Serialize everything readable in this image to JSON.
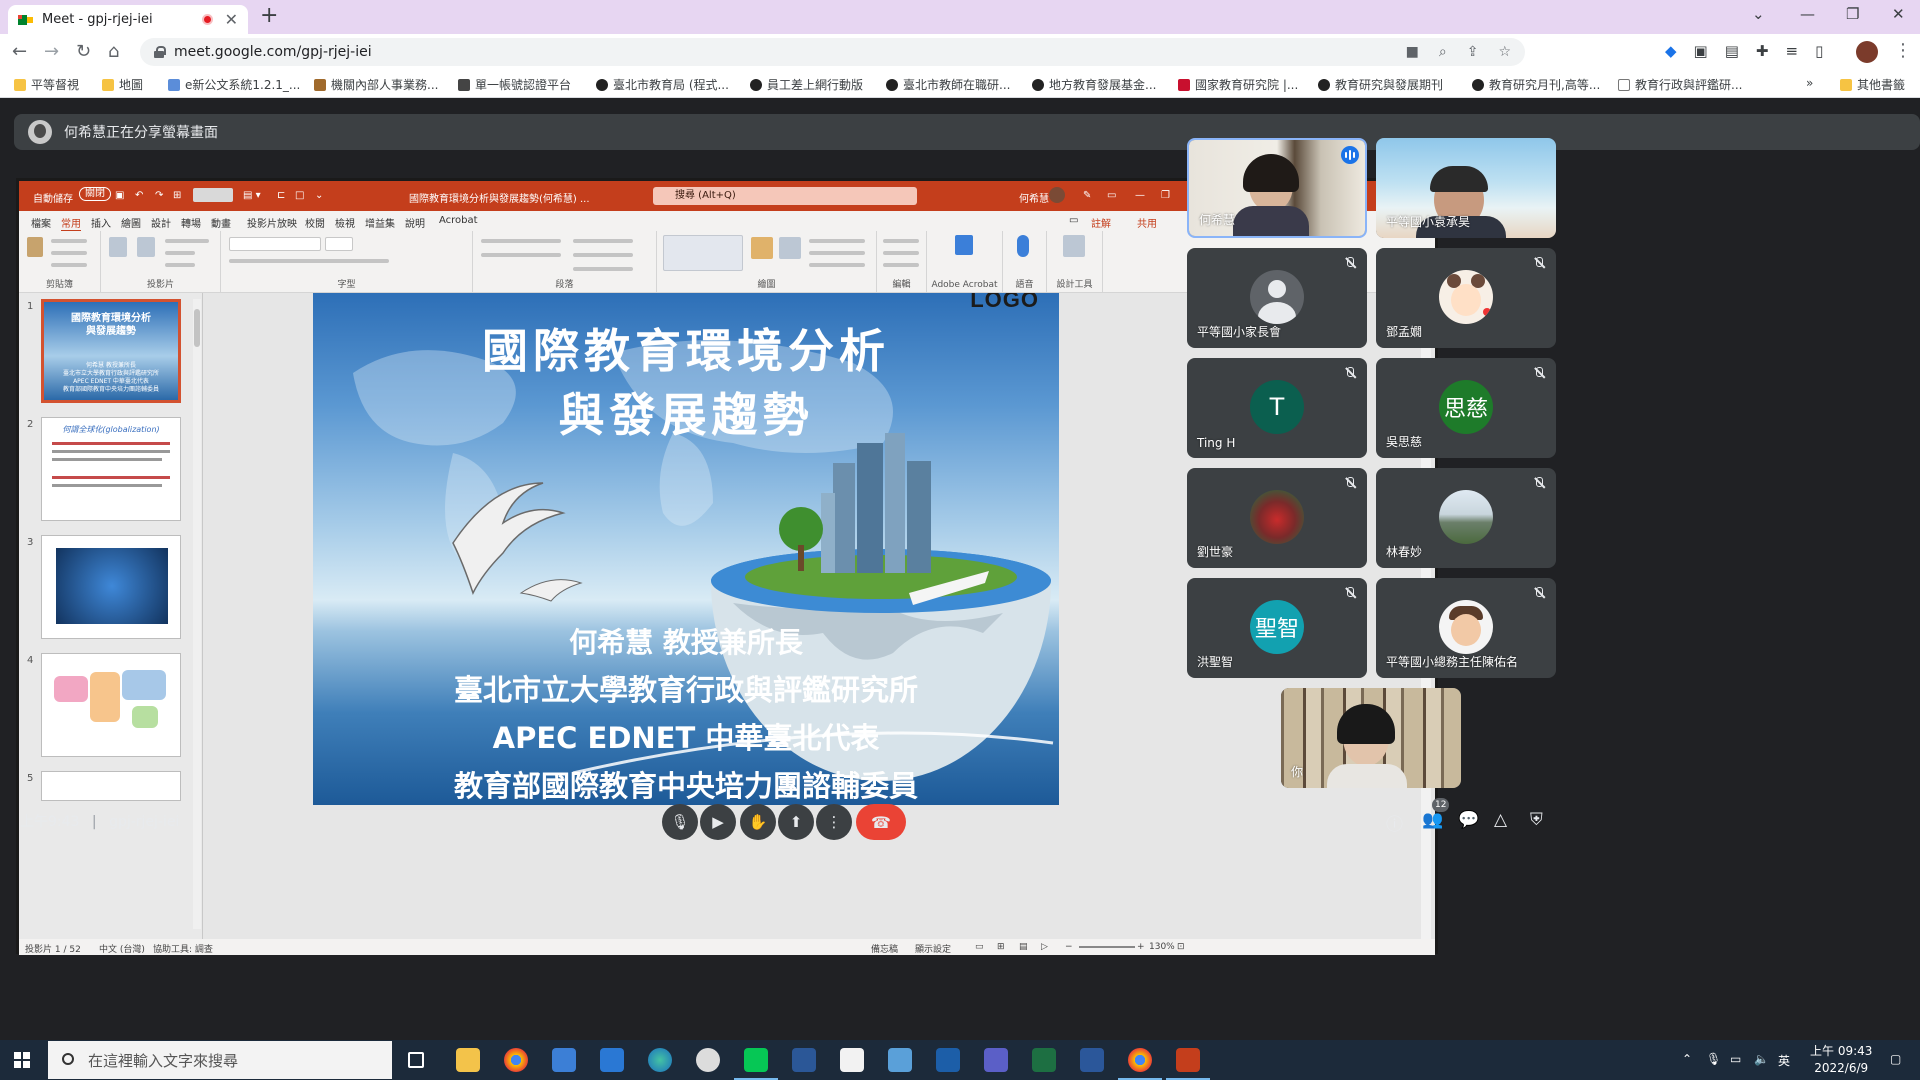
{
  "browser": {
    "tab_title": "Meet - gpj-rjej-iei",
    "url": "meet.google.com/gpj-rjej-iei",
    "bookmarks": [
      "平等督視",
      "地圖",
      "e新公文系統1.2.1_...",
      "機關內部人事業務...",
      "單一帳號認證平台",
      "臺北市教育局 (程式...",
      "員工差上網行動版",
      "臺北市教師在職研...",
      "地方教育發展基金...",
      "國家教育研究院 |...",
      "教育研究與發展期刊",
      "教育研究月刊,高等...",
      "教育行政與評鑑研...",
      "其他書籤"
    ]
  },
  "meet": {
    "presenting_text": "何希慧正在分享螢幕畫面",
    "meeting_code": "gpj-rjej-iei",
    "time": "上午9:43",
    "participant_count": "12",
    "participants": [
      {
        "name": "何希慧",
        "kind": "video",
        "speaking": true
      },
      {
        "name": "平等國小袁承昊",
        "kind": "video"
      },
      {
        "name": "平等國小家長會",
        "kind": "default",
        "muted": true
      },
      {
        "name": "鄧孟嫺",
        "kind": "emoji",
        "muted": true
      },
      {
        "name": "Ting H",
        "kind": "letter",
        "letter": "T",
        "color": "#0b5f4f",
        "muted": true
      },
      {
        "name": "吳思慈",
        "kind": "letter",
        "letter": "思慈",
        "color": "#1e7b2a",
        "muted": true
      },
      {
        "name": "劉世豪",
        "kind": "photo",
        "muted": true
      },
      {
        "name": "林春妙",
        "kind": "photo",
        "muted": true
      },
      {
        "name": "洪聖智",
        "kind": "letter",
        "letter": "聖智",
        "color": "#12a1b0",
        "muted": true
      },
      {
        "name": "平等國小總務主任陳佑名",
        "kind": "emoji",
        "muted": true
      },
      {
        "name": "你",
        "kind": "self"
      }
    ]
  },
  "ppt": {
    "autosave": "自動儲存",
    "autosave_state": "關閉",
    "doc_title": "國際教育環境分析與發展趨勢(何希慧) ...",
    "search_placeholder": "搜尋 (Alt+Q)",
    "user": "何希慧",
    "menu": [
      "檔案",
      "常用",
      "插入",
      "繪圖",
      "設計",
      "轉場",
      "動畫",
      "投影片放映",
      "校閱",
      "檢視",
      "增益集",
      "說明",
      "Acrobat"
    ],
    "active_menu": "常用",
    "comment_btn": "註解",
    "share_btn": "共用",
    "ribbon_groups": [
      "剪貼簿",
      "投影片",
      "字型",
      "段落",
      "繪圖",
      "編輯",
      "Adobe Acrobat",
      "語音",
      "設計工具"
    ],
    "status_left": "投影片 1 / 52",
    "status_lang": "中文 (台灣)",
    "status_access": "協助工具: 調查",
    "status_notes": "備忘稿",
    "status_display": "顯示設定",
    "zoom": "130%",
    "thumb2_title": "何謂全球化(globalization)",
    "slide": {
      "logo": "LOGO",
      "title_line1": "國際教育環境分析",
      "title_line2": "與發展趨勢",
      "sub1": "何希慧 教授兼所長",
      "sub2": "臺北市立大學教育行政與評鑑研究所",
      "sub3": "APEC EDNET 中華臺北代表",
      "sub4": "教育部國際教育中央培力團諮輔委員"
    }
  },
  "taskbar": {
    "search_placeholder": "在這裡輸入文字來搜尋",
    "time": "上午 09:43",
    "date": "2022/6/9",
    "ime": "英"
  }
}
